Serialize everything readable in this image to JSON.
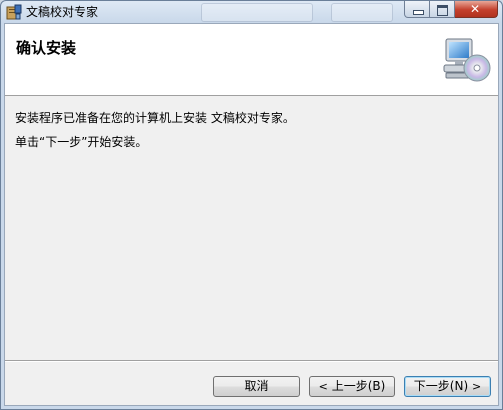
{
  "window": {
    "title": "文稿校对专家"
  },
  "banner": {
    "title": "确认安装",
    "icon": "computer-cd-icon"
  },
  "content": {
    "line1": "安装程序已准备在您的计算机上安装 文稿校对专家。",
    "line2": "单击“下一步”开始安装。"
  },
  "buttons": {
    "cancel": "取消",
    "back_arrow": "<",
    "back": "上一步(B)",
    "next": "下一步(N)",
    "next_arrow": ">"
  },
  "colors": {
    "close_button": "#c4402d",
    "window_frame": "#c9d8ea",
    "default_button_border": "#3c7fb1"
  }
}
